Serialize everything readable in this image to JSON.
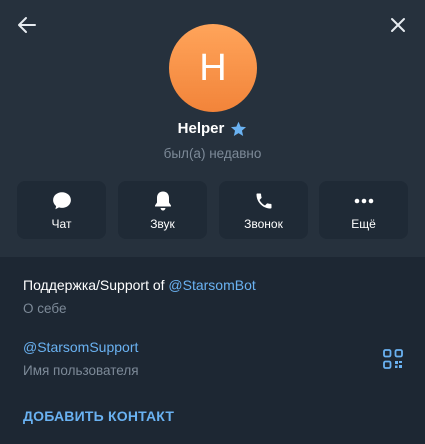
{
  "profile": {
    "avatar_letter": "H",
    "name": "Helper",
    "status": "был(а) недавно"
  },
  "actions": [
    {
      "label": "Чат",
      "icon": "chat-bubble-icon"
    },
    {
      "label": "Звук",
      "icon": "bell-icon"
    },
    {
      "label": "Звонок",
      "icon": "phone-icon"
    },
    {
      "label": "Ещё",
      "icon": "more-dots-icon"
    }
  ],
  "info": {
    "bio_text": "Поддержка/Support of ",
    "bio_link": "@StarsomBot",
    "bio_caption": "О себе",
    "username": "@StarsomSupport",
    "username_caption": "Имя пользователя"
  },
  "add_contact_label": "ДОБАВИТЬ КОНТАКТ",
  "colors": {
    "header_bg": "#26313d",
    "body_bg": "#1d2733",
    "accent": "#6ab2f2",
    "avatar": "#f7933f",
    "muted": "#7d8a98"
  }
}
